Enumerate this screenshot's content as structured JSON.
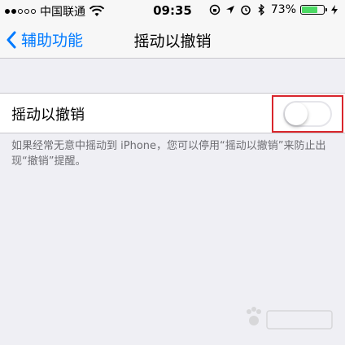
{
  "status_bar": {
    "carrier": "中国联通",
    "time": "09:35",
    "battery_percent": "73%",
    "battery_level": 0.73,
    "battery_color": "#4cd964"
  },
  "nav": {
    "back_label": "辅助功能",
    "title": "摇动以撤销",
    "accent_color": "#007aff"
  },
  "setting": {
    "label": "摇动以撤销",
    "toggle_on": false
  },
  "footer_note": "如果经常无意中摇动到 iPhone，您可以停用“摇动以撤销”来防止出现“撤销”提醒。",
  "highlight_color": "#d9262c"
}
